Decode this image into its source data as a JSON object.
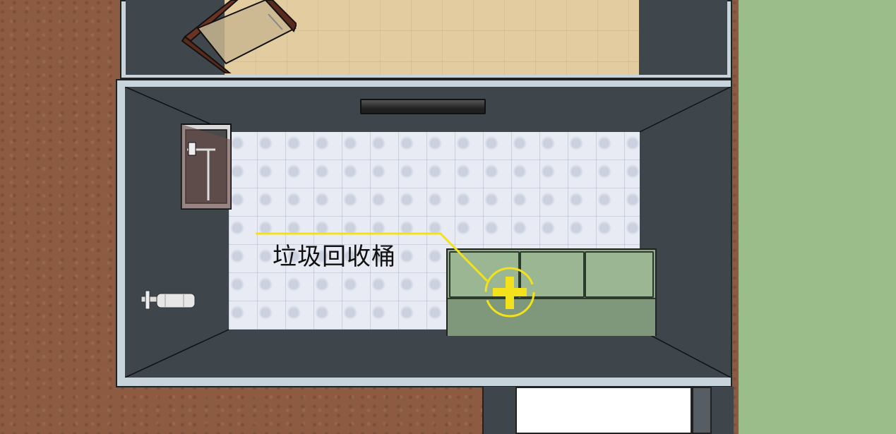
{
  "annotation": {
    "label": "垃圾回收桶",
    "color": "#f3e21b",
    "marker_icon": "crosshair-plus-icon"
  },
  "objects": {
    "waste_bin": "recycling-bin",
    "wall_vent": "vent",
    "cabinet": "wall-cabinet",
    "pipe": "water-pipe",
    "chair": "chair"
  },
  "colors": {
    "wall_fill": "#3e454b",
    "wall_edge": "#c8d4dc",
    "top_floor": "#e3cda0",
    "main_floor": "#e8ebf3",
    "ground": "#8d5b41",
    "grass": "#9bbd8a",
    "bin": "#8fa888"
  }
}
